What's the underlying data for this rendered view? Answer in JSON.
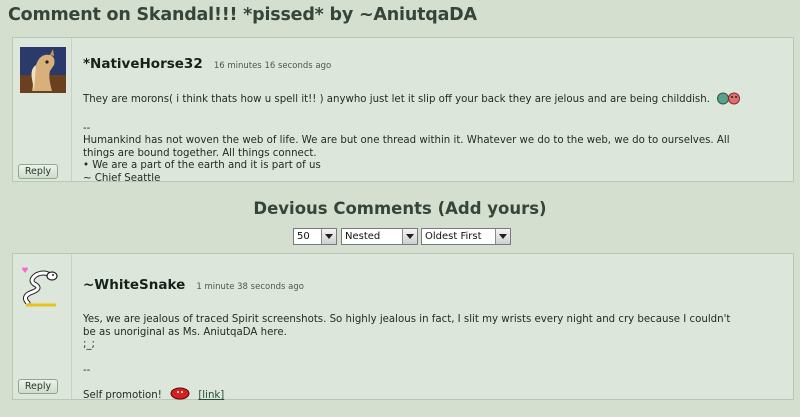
{
  "page": {
    "title": "Comment on Skandal!!! *pissed* by ~AniutqaDA"
  },
  "comments": [
    {
      "author": "*NativeHorse32",
      "time": "16 minutes 16 seconds ago",
      "text": "They are morons( i think thats how u spell it!! ) anywho just let it slip off your back they are jelous and are being childdish.",
      "sig_sep": "--",
      "signature": [
        "Humankind has not woven the web of life. We are but one thread within it. Whatever we do to the web, we do to ourselves. All",
        "things are bound together. All things connect.",
        "• We are a part of the earth and it is part of us",
        "~ Chief Seattle"
      ],
      "reply_label": "Reply"
    },
    {
      "author": "~WhiteSnake",
      "time": "1 minute 38 seconds ago",
      "text_lines": [
        "Yes, we are jealous of traced Spirit screenshots. So highly jealous in fact, I slit my wrists every night and cry because I couldn't",
        "be as unoriginal as Ms. AniutqaDA here.",
        ";_;"
      ],
      "sig_sep": "--",
      "promo_text": "Self promotion!",
      "promo_link": "[link]",
      "reply_label": "Reply"
    }
  ],
  "devious_comments": {
    "title": "Devious Comments (Add yours)",
    "count_select": "50",
    "view_select": "Nested",
    "order_select": "Oldest First"
  }
}
